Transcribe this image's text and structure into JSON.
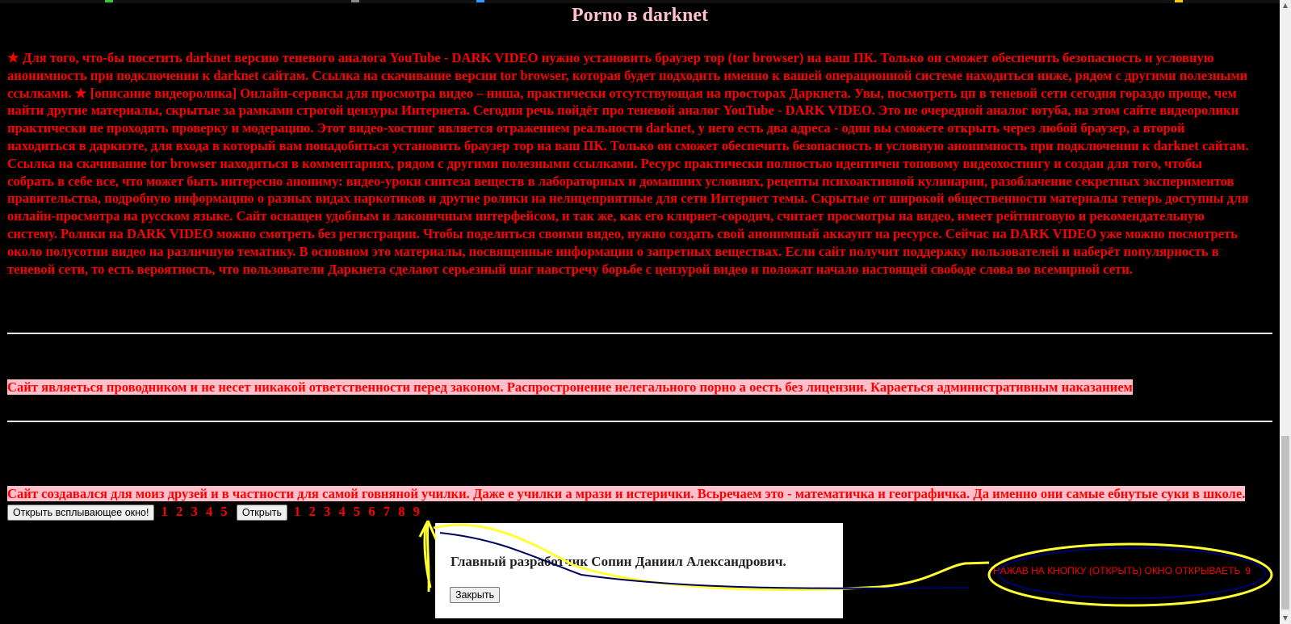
{
  "page": {
    "title": "Porno в darknet",
    "main_text": "★ Для того, что-бы посетить darknet версию теневого аналога YouTube - DARK VIDEO нужно установить браузер тор (tor browser) на ваш ПК. Только он сможет обеспечить безопасность и условную анонимность при подключении к darknet сайтам. Ссылка на скачивание версии tor browser, которая будет подходить именно к вашей операционной системе находиться ниже, рядом с другими полезными ссылками. ★ [описание видеоролика] Онлайн-сервисы для просмотра видео – ниша, практически отсутствующая на просторах Даркнета. Увы, посмотреть цп в теневой сети сегодня гораздо проще, чем найти другие материалы, скрытые за рамками строгой цензуры Интернета. Сегодня речь пойдёт про теневой аналог YouTube - DARK VIDEO. Это не очередной аналог ютуба, на этом сайте видеоролики практически не проходять проверку и модерацию. Этот видео-хостинг является отражением реальности darknet, у него есть два адреса - один вы сможете открыть через любой браузер, а второй находиться в даркнэте, для входа в который вам понадобиться установить браузер тор на ваш ПК. Только он сможет обеспечить безопасность и условную анонимность при подключении к darknet сайтам. Ссылка на скачивание tor browser находиться в комментариях, рядом с другими полезными ссылками. Ресурс практически полностью идентичен топовому видеохостингу и создан для того, чтобы собрать в себе все, что может быть интересно анониму: видео-уроки синтеза веществ в лабораторных и домашних условиях, рецепты психоактивной кулинарии, разоблачение секретных экспериментов правительства, подробную информацию о разных видах наркотиков и другие ролики на нелицеприятные для сети Интернет темы. Скрытые от широкой общественности материалы теперь доступны для онлайн-просмотра на русском языке. Сайт оснащен удобным и лаконичным интерфейсом, и так же, как его клирнет-сородич, считает просмотры на видео, имеет рейтинговую и рекомендательную систему. Ролики на DARK VIDEO можно смотреть без регистрации. Чтобы поделиться своими видео, нужно создать свой анонимный аккаунт на ресурсе. Сейчас на DARK VIDEO уже можно посмотреть около полусотни видео на различную тематику. В основном это материалы, посвященные информации о запретных веществах. Если сайт получит поддержку пользователей и наберёт популярность в теневой сети, то есть вероятность, что пользователи Даркнета сделают серьезный шаг навстречу борьбе с цензурой видео и положат начало настоящей свободе слова во всемирной сети.",
    "disclaimer": "Сайт являеться проводником и не несет никакой ответственности перед законом. Распростронение нелегального порно а оесть без лицензии. Караеться административным наказанием",
    "note": "Сайт создавался для моиз друзей и в частности для самой говняной училки. Даже е училки а мрази и истерички. Всьречаем это - математичка и географичка. Да именно они самые ебнутые суки в школе."
  },
  "buttons": {
    "open_popup": "Открыть всплывающее окно!",
    "numbers_1": "1 2 3 4 5",
    "open": "Открыть",
    "numbers_2": "1 2 3 4 5 6 7 8 9"
  },
  "popup": {
    "message": "Главный разработчик Сопин Даниил Александрович.",
    "close": "Закрыть"
  },
  "annotation": {
    "label": "НАЖАВ НА КНОПКУ (ОТКРЫТЬ) ОКНО ОТКРЫВАЕТЬ",
    "trailing": "9"
  },
  "colors": {
    "text": "#ff0000",
    "highlight": "#ffc0cb",
    "background": "#000000",
    "scribble": "#ffff33"
  }
}
